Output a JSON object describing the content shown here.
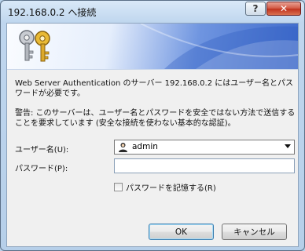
{
  "window": {
    "title": "192.168.0.2 へ接続",
    "help_label": "?",
    "close_label": "✕"
  },
  "banner": {
    "icon": "keys-icon"
  },
  "message": "Web Server Authentication のサーバー 192.168.0.2 にはユーザー名とパスワードが必要です。",
  "warning": "警告: このサーバーは、ユーザー名とパスワードを安全ではない方法で送信することを要求しています (安全な接続を使わない基本的な認証)。",
  "form": {
    "username_label": "ユーザー名(U):",
    "username_value": "admin",
    "username_icon": "user-icon",
    "password_label": "パスワード(P):",
    "password_value": "",
    "remember_label": "パスワードを記憶する(R)",
    "remember_checked": false
  },
  "buttons": {
    "ok_label": "OK",
    "cancel_label": "キャンセル"
  },
  "colors": {
    "title_bar": "#bfd6ee",
    "close_button": "#c0331f",
    "banner_accent": "#3f6bcc",
    "default_button_border": "#3c7fb1"
  }
}
